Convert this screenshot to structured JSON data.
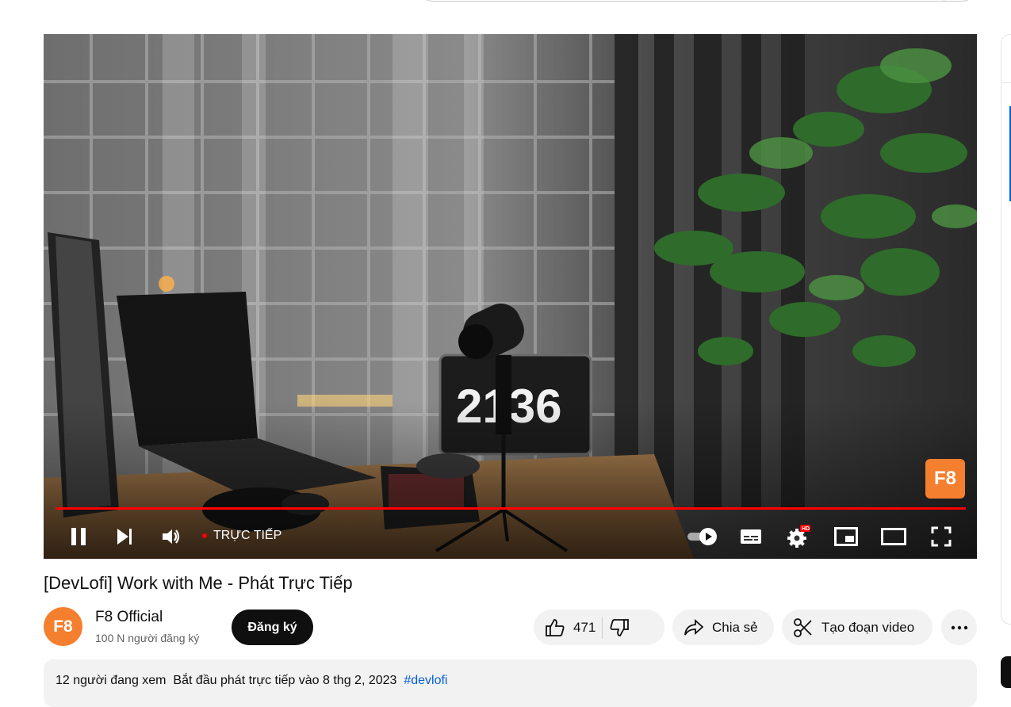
{
  "video": {
    "title": "[DevLofi] Work with Me - Phát Trực Tiếp",
    "live_label": "TRỰC TIẾP",
    "clock_text": "2136",
    "watermark": "F8",
    "hd_badge": "HD",
    "progress": 1.0
  },
  "channel": {
    "avatar_text": "F8",
    "name": "F8 Official",
    "subscribers": "100 N người đăng ký",
    "subscribe_label": "Đăng ký"
  },
  "actions": {
    "likes": "471",
    "share_label": "Chia sẻ",
    "clip_label": "Tạo đoạn video"
  },
  "description": {
    "viewers": "12 người đang xem",
    "started": "Bắt đầu phát trực tiếp vào 8 thg 2, 2023",
    "hashtag": "#devlofi"
  },
  "colors": {
    "accent_red": "#ff0000",
    "brand_orange": "#f47f2f",
    "link_blue": "#065fd4"
  },
  "icons": [
    "pause-icon",
    "next-icon",
    "volume-icon",
    "autoplay-toggle-icon",
    "subtitles-icon",
    "settings-icon",
    "miniplayer-icon",
    "theater-icon",
    "fullscreen-icon",
    "like-icon",
    "dislike-icon",
    "share-icon",
    "clip-icon",
    "more-icon"
  ]
}
